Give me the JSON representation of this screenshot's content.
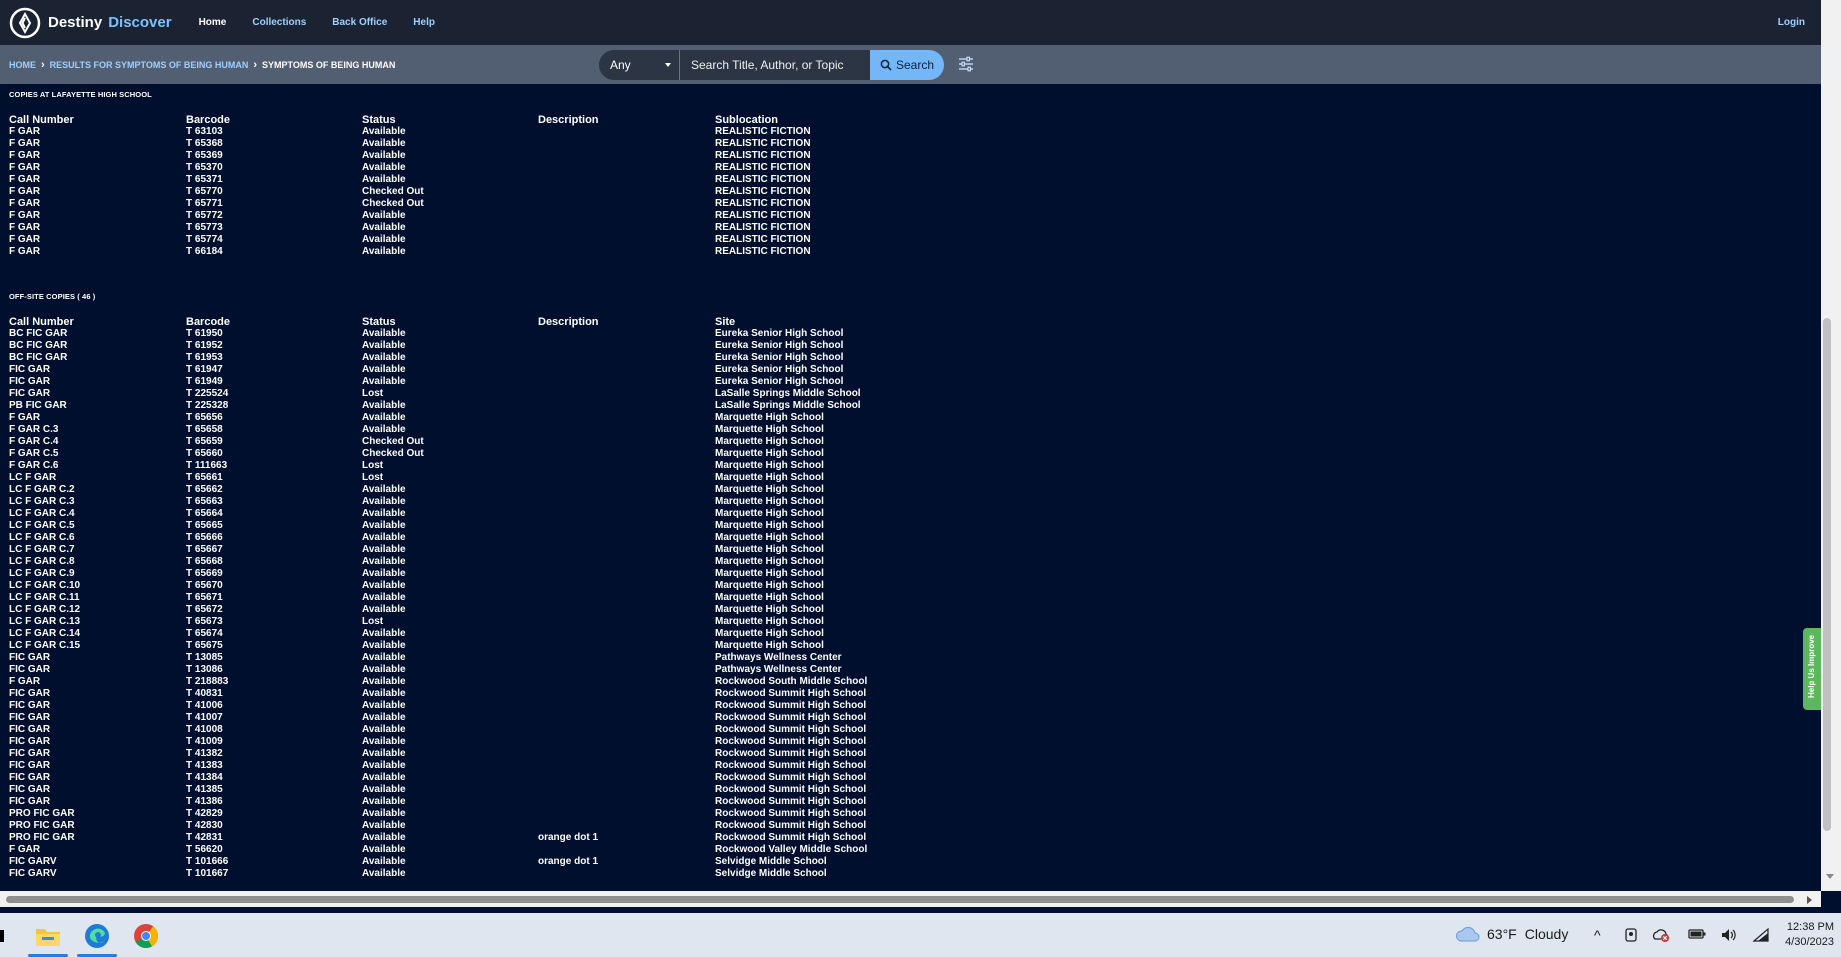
{
  "brand": {
    "name": "Destiny",
    "product": "Discover"
  },
  "nav": {
    "links": [
      "Home",
      "Collections",
      "Back Office",
      "Help"
    ],
    "login": "Login"
  },
  "breadcrumb": {
    "home": "HOME",
    "results": "RESULTS FOR SYMPTOMS OF BEING HUMAN",
    "current": "SYMPTOMS OF BEING HUMAN"
  },
  "search": {
    "scope": "Any",
    "placeholder": "Search Title, Author, or Topic",
    "button": "Search"
  },
  "local_copies": {
    "title": "COPIES AT LAFAYETTE HIGH SCHOOL",
    "headers": [
      "Call Number",
      "Barcode",
      "Status",
      "Description",
      "Sublocation"
    ],
    "rows": [
      [
        "F GAR",
        "T 63103",
        "Available",
        "",
        "REALISTIC FICTION"
      ],
      [
        "F GAR",
        "T 65368",
        "Available",
        "",
        "REALISTIC FICTION"
      ],
      [
        "F GAR",
        "T 65369",
        "Available",
        "",
        "REALISTIC FICTION"
      ],
      [
        "F GAR",
        "T 65370",
        "Available",
        "",
        "REALISTIC FICTION"
      ],
      [
        "F GAR",
        "T 65371",
        "Available",
        "",
        "REALISTIC FICTION"
      ],
      [
        "F GAR",
        "T 65770",
        "Checked Out",
        "",
        "REALISTIC FICTION"
      ],
      [
        "F GAR",
        "T 65771",
        "Checked Out",
        "",
        "REALISTIC FICTION"
      ],
      [
        "F GAR",
        "T 65772",
        "Available",
        "",
        "REALISTIC FICTION"
      ],
      [
        "F GAR",
        "T 65773",
        "Available",
        "",
        "REALISTIC FICTION"
      ],
      [
        "F GAR",
        "T 65774",
        "Available",
        "",
        "REALISTIC FICTION"
      ],
      [
        "F GAR",
        "T 66184",
        "Available",
        "",
        "REALISTIC FICTION"
      ]
    ]
  },
  "offsite_copies": {
    "title": "OFF-SITE COPIES ( 46 )",
    "headers": [
      "Call Number",
      "Barcode",
      "Status",
      "Description",
      "Site"
    ],
    "rows": [
      [
        "BC FIC GAR",
        "T 61950",
        "Available",
        "",
        "Eureka Senior High School"
      ],
      [
        "BC FIC GAR",
        "T 61952",
        "Available",
        "",
        "Eureka Senior High School"
      ],
      [
        "BC FIC GAR",
        "T 61953",
        "Available",
        "",
        "Eureka Senior High School"
      ],
      [
        "FIC GAR",
        "T 61947",
        "Available",
        "",
        "Eureka Senior High School"
      ],
      [
        "FIC GAR",
        "T 61949",
        "Available",
        "",
        "Eureka Senior High School"
      ],
      [
        "FIC GAR",
        "T 225524",
        "Lost",
        "",
        "LaSalle Springs Middle School"
      ],
      [
        "PB FIC GAR",
        "T 225328",
        "Available",
        "",
        "LaSalle Springs Middle School"
      ],
      [
        "F GAR",
        "T 65656",
        "Available",
        "",
        "Marquette High School"
      ],
      [
        "F GAR C.3",
        "T 65658",
        "Available",
        "",
        "Marquette High School"
      ],
      [
        "F GAR C.4",
        "T 65659",
        "Checked Out",
        "",
        "Marquette High School"
      ],
      [
        "F GAR C.5",
        "T 65660",
        "Checked Out",
        "",
        "Marquette High School"
      ],
      [
        "F GAR C.6",
        "T 111663",
        "Lost",
        "",
        "Marquette High School"
      ],
      [
        "LC F GAR",
        "T 65661",
        "Lost",
        "",
        "Marquette High School"
      ],
      [
        "LC F GAR C.2",
        "T 65662",
        "Available",
        "",
        "Marquette High School"
      ],
      [
        "LC F GAR C.3",
        "T 65663",
        "Available",
        "",
        "Marquette High School"
      ],
      [
        "LC F GAR C.4",
        "T 65664",
        "Available",
        "",
        "Marquette High School"
      ],
      [
        "LC F GAR C.5",
        "T 65665",
        "Available",
        "",
        "Marquette High School"
      ],
      [
        "LC F GAR C.6",
        "T 65666",
        "Available",
        "",
        "Marquette High School"
      ],
      [
        "LC F GAR C.7",
        "T 65667",
        "Available",
        "",
        "Marquette High School"
      ],
      [
        "LC F GAR C.8",
        "T 65668",
        "Available",
        "",
        "Marquette High School"
      ],
      [
        "LC F GAR C.9",
        "T 65669",
        "Available",
        "",
        "Marquette High School"
      ],
      [
        "LC F GAR C.10",
        "T 65670",
        "Available",
        "",
        "Marquette High School"
      ],
      [
        "LC F GAR C.11",
        "T 65671",
        "Available",
        "",
        "Marquette High School"
      ],
      [
        "LC F GAR C.12",
        "T 65672",
        "Available",
        "",
        "Marquette High School"
      ],
      [
        "LC F GAR C.13",
        "T 65673",
        "Lost",
        "",
        "Marquette High School"
      ],
      [
        "LC F GAR C.14",
        "T 65674",
        "Available",
        "",
        "Marquette High School"
      ],
      [
        "LC F GAR C.15",
        "T 65675",
        "Available",
        "",
        "Marquette High School"
      ],
      [
        "FIC GAR",
        "T 13085",
        "Available",
        "",
        "Pathways Wellness Center"
      ],
      [
        "FIC GAR",
        "T 13086",
        "Available",
        "",
        "Pathways Wellness Center"
      ],
      [
        "F GAR",
        "T 218883",
        "Available",
        "",
        "Rockwood South Middle School"
      ],
      [
        "FIC GAR",
        "T 40831",
        "Available",
        "",
        "Rockwood Summit High School"
      ],
      [
        "FIC GAR",
        "T 41006",
        "Available",
        "",
        "Rockwood Summit High School"
      ],
      [
        "FIC GAR",
        "T 41007",
        "Available",
        "",
        "Rockwood Summit High School"
      ],
      [
        "FIC GAR",
        "T 41008",
        "Available",
        "",
        "Rockwood Summit High School"
      ],
      [
        "FIC GAR",
        "T 41009",
        "Available",
        "",
        "Rockwood Summit High School"
      ],
      [
        "FIC GAR",
        "T 41382",
        "Available",
        "",
        "Rockwood Summit High School"
      ],
      [
        "FIC GAR",
        "T 41383",
        "Available",
        "",
        "Rockwood Summit High School"
      ],
      [
        "FIC GAR",
        "T 41384",
        "Available",
        "",
        "Rockwood Summit High School"
      ],
      [
        "FIC GAR",
        "T 41385",
        "Available",
        "",
        "Rockwood Summit High School"
      ],
      [
        "FIC GAR",
        "T 41386",
        "Available",
        "",
        "Rockwood Summit High School"
      ],
      [
        "PRO FIC GAR",
        "T 42829",
        "Available",
        "",
        "Rockwood Summit High School"
      ],
      [
        "PRO FIC GAR",
        "T 42830",
        "Available",
        "",
        "Rockwood Summit High School"
      ],
      [
        "PRO FIC GAR",
        "T 42831",
        "Available",
        "orange dot 1",
        "Rockwood Summit High School"
      ],
      [
        "F GAR",
        "T 56620",
        "Available",
        "",
        "Rockwood Valley Middle School"
      ],
      [
        "FIC GARV",
        "T 101666",
        "Available",
        "orange dot 1",
        "Selvidge Middle School"
      ],
      [
        "FIC GARV",
        "T 101667",
        "Available",
        "",
        "Selvidge Middle School"
      ]
    ]
  },
  "feedback_tab": "Help Us Improve",
  "taskbar": {
    "weather_temp": "63°F",
    "weather_desc": "Cloudy",
    "time": "12:38 PM",
    "date": "4/30/2023"
  }
}
